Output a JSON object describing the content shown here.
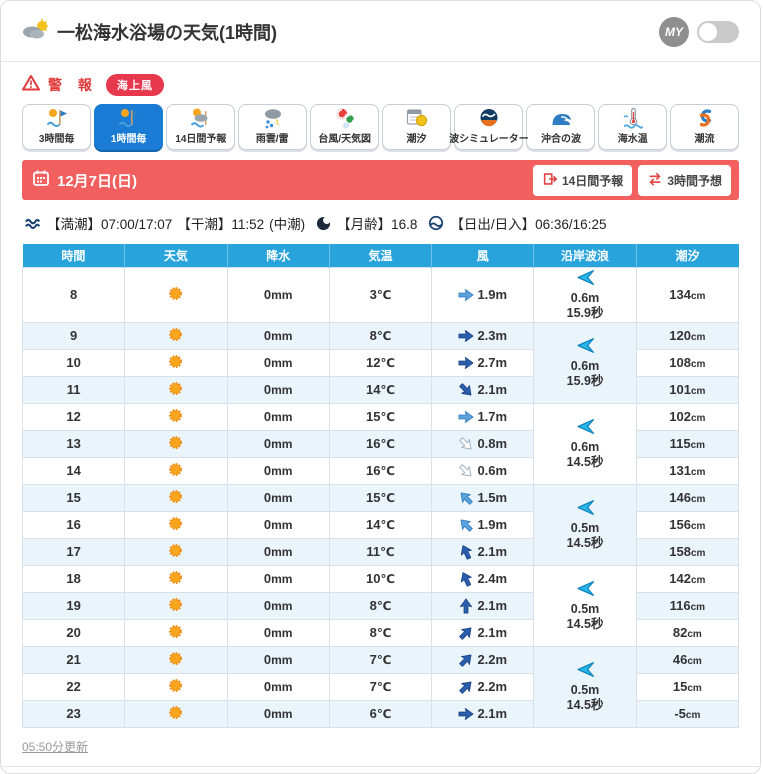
{
  "header": {
    "title": "一松海水浴場の天気(1時間)",
    "my_label": "MY",
    "weather_icon": "cloud-sun-icon"
  },
  "alerts": {
    "warning_label": "警 報",
    "badge_label": "海上風"
  },
  "tabs": [
    {
      "name": "tab-3hourly",
      "label": "3時間毎",
      "icon": "sun-windsock-icon",
      "selected": false
    },
    {
      "name": "tab-1hourly",
      "label": "1時間毎",
      "icon": "sun-windsock-icon",
      "selected": true
    },
    {
      "name": "tab-14day",
      "label": "14日間予報",
      "icon": "sun-cloud-icon",
      "selected": false
    },
    {
      "name": "tab-raincloud",
      "label": "雨雲/雷",
      "icon": "rain-lightning-icon",
      "selected": false
    },
    {
      "name": "tab-typhoon",
      "label": "台風/天気図",
      "icon": "typhoon-map-icon",
      "selected": false
    },
    {
      "name": "tab-tide",
      "label": "潮汐",
      "icon": "tide-calendar-icon",
      "selected": false
    },
    {
      "name": "tab-wavesim",
      "label": "波シミュレーター",
      "icon": "wave-simulator-icon",
      "selected": false
    },
    {
      "name": "tab-offshorewave",
      "label": "沖合の波",
      "icon": "offshore-wave-icon",
      "selected": false
    },
    {
      "name": "tab-seatemp",
      "label": "海水温",
      "icon": "sea-temp-icon",
      "selected": false
    },
    {
      "name": "tab-current",
      "label": "潮流",
      "icon": "current-icon",
      "selected": false
    }
  ],
  "date_bar": {
    "date": "12月7日(日)",
    "buttons": [
      {
        "label": "14日間予報",
        "icon": "export-icon"
      },
      {
        "label": "3時間予想",
        "icon": "switch-icon"
      }
    ],
    "bg_color": "#f15f5f"
  },
  "tide_info": {
    "high_tide": "【満潮】07:00/17:07",
    "low_tide": "【干潮】11:52",
    "phase": "(中潮)",
    "moon_age": "【月齢】16.8",
    "sun_times": "【日出/日入】06:36/16:25"
  },
  "table": {
    "columns": [
      "時間",
      "天気",
      "降水",
      "気温",
      "風",
      "沿岸波浪",
      "潮汐"
    ],
    "units": {
      "precip": "mm",
      "temp": "℃",
      "wind": "m",
      "tide": "cm"
    },
    "header_color": "#29a3dc",
    "rows": [
      {
        "hour": "8",
        "weather": "sunny",
        "precip": "0",
        "temp": "3",
        "wind": {
          "dir": 90,
          "level": "mid",
          "speed": "1.9"
        },
        "tide": "134"
      },
      {
        "hour": "9",
        "weather": "sunny",
        "precip": "0",
        "temp": "8",
        "wind": {
          "dir": 90,
          "level": "strong",
          "speed": "2.3"
        },
        "tide": "120"
      },
      {
        "hour": "10",
        "weather": "sunny",
        "precip": "0",
        "temp": "12",
        "wind": {
          "dir": 90,
          "level": "strong",
          "speed": "2.7"
        },
        "tide": "108"
      },
      {
        "hour": "11",
        "weather": "sunny",
        "precip": "0",
        "temp": "14",
        "wind": {
          "dir": 135,
          "level": "strong",
          "speed": "2.1"
        },
        "tide": "101"
      },
      {
        "hour": "12",
        "weather": "sunny",
        "precip": "0",
        "temp": "15",
        "wind": {
          "dir": 90,
          "level": "mid",
          "speed": "1.7"
        },
        "tide": "102"
      },
      {
        "hour": "13",
        "weather": "sunny",
        "precip": "0",
        "temp": "16",
        "wind": {
          "dir": 135,
          "level": "weak",
          "speed": "0.8"
        },
        "tide": "115"
      },
      {
        "hour": "14",
        "weather": "sunny",
        "precip": "0",
        "temp": "16",
        "wind": {
          "dir": 135,
          "level": "weak",
          "speed": "0.6"
        },
        "tide": "131"
      },
      {
        "hour": "15",
        "weather": "sunny",
        "precip": "0",
        "temp": "15",
        "wind": {
          "dir": -45,
          "level": "mid",
          "speed": "1.5"
        },
        "tide": "146"
      },
      {
        "hour": "16",
        "weather": "sunny",
        "precip": "0",
        "temp": "14",
        "wind": {
          "dir": -45,
          "level": "mid",
          "speed": "1.9"
        },
        "tide": "156"
      },
      {
        "hour": "17",
        "weather": "sunny",
        "precip": "0",
        "temp": "11",
        "wind": {
          "dir": -25,
          "level": "strong",
          "speed": "2.1"
        },
        "tide": "158"
      },
      {
        "hour": "18",
        "weather": "sunny",
        "precip": "0",
        "temp": "10",
        "wind": {
          "dir": -25,
          "level": "strong",
          "speed": "2.4"
        },
        "tide": "142"
      },
      {
        "hour": "19",
        "weather": "sunny",
        "precip": "0",
        "temp": "8",
        "wind": {
          "dir": 0,
          "level": "strong",
          "speed": "2.1"
        },
        "tide": "116"
      },
      {
        "hour": "20",
        "weather": "sunny",
        "precip": "0",
        "temp": "8",
        "wind": {
          "dir": 45,
          "level": "strong",
          "speed": "2.1"
        },
        "tide": "82"
      },
      {
        "hour": "21",
        "weather": "sunny",
        "precip": "0",
        "temp": "7",
        "wind": {
          "dir": 45,
          "level": "strong",
          "speed": "2.2"
        },
        "tide": "46"
      },
      {
        "hour": "22",
        "weather": "sunny",
        "precip": "0",
        "temp": "7",
        "wind": {
          "dir": 45,
          "level": "strong",
          "speed": "2.2"
        },
        "tide": "15"
      },
      {
        "hour": "23",
        "weather": "sunny",
        "precip": "0",
        "temp": "6",
        "wind": {
          "dir": 90,
          "level": "strong",
          "speed": "2.1"
        },
        "tide": "-5"
      }
    ],
    "wave_groups": [
      {
        "start": 0,
        "span": 1,
        "height": "0.6m",
        "period": "15.9秒",
        "direction": "left"
      },
      {
        "start": 1,
        "span": 3,
        "height": "0.6m",
        "period": "15.9秒",
        "direction": "left"
      },
      {
        "start": 4,
        "span": 3,
        "height": "0.6m",
        "period": "14.5秒",
        "direction": "left"
      },
      {
        "start": 7,
        "span": 3,
        "height": "0.5m",
        "period": "14.5秒",
        "direction": "left"
      },
      {
        "start": 10,
        "span": 3,
        "height": "0.5m",
        "period": "14.5秒",
        "direction": "left"
      },
      {
        "start": 13,
        "span": 3,
        "height": "0.5m",
        "period": "14.5秒",
        "direction": "left"
      }
    ]
  },
  "footer": {
    "updated": "05:50分更新"
  }
}
